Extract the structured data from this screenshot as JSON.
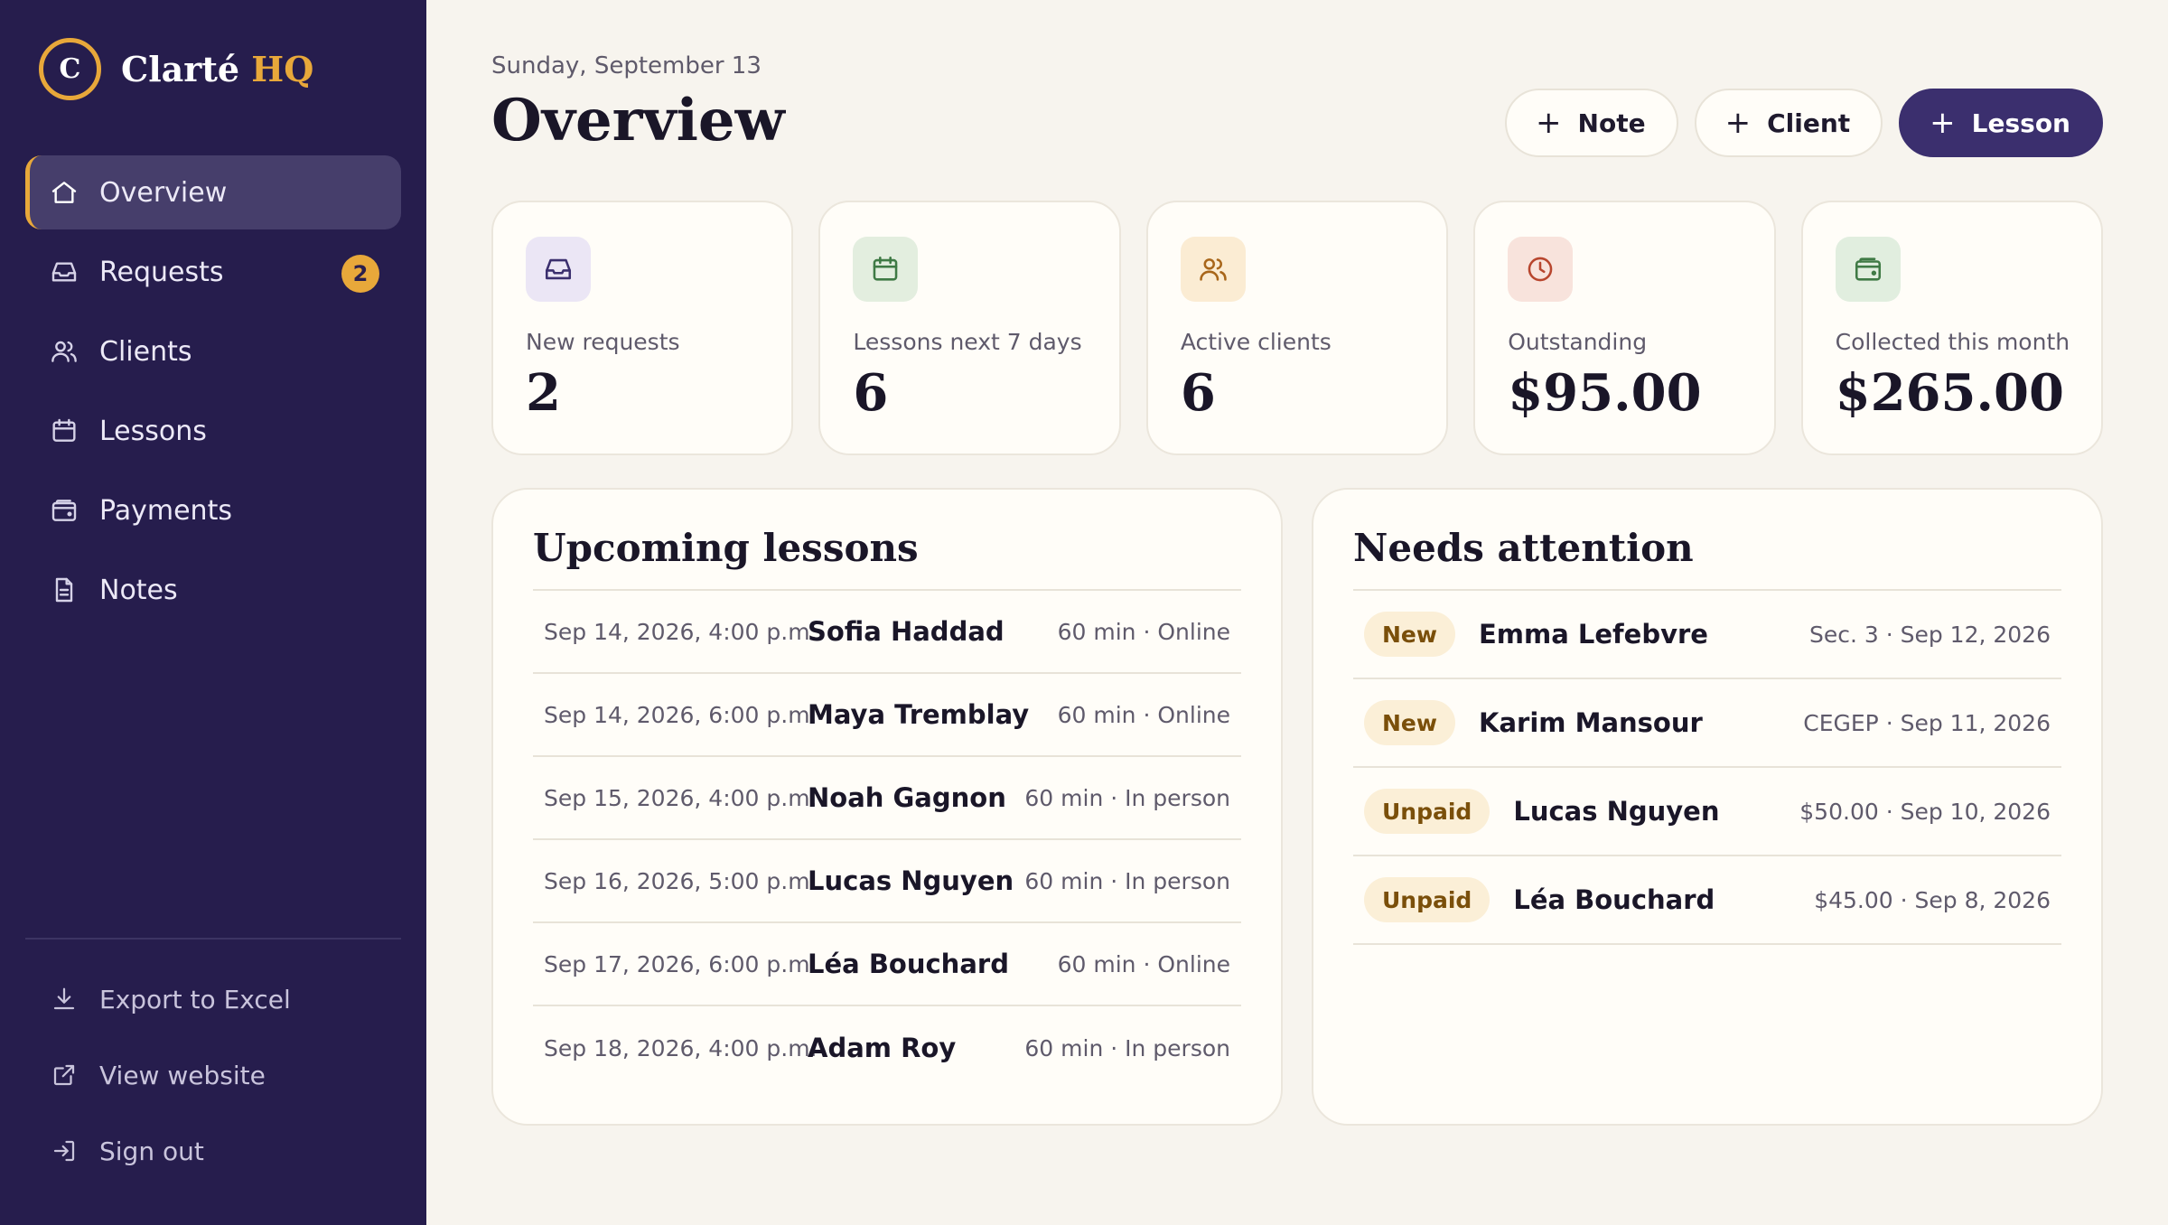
{
  "brand": {
    "logo_letter": "C",
    "name": "Clarté",
    "accent": "HQ",
    "accent_color": "#e8a83a"
  },
  "sidebar": {
    "items": [
      {
        "label": "Overview",
        "icon": "home-icon",
        "active": true
      },
      {
        "label": "Requests",
        "icon": "inbox-icon",
        "badge": "2"
      },
      {
        "label": "Clients",
        "icon": "users-icon"
      },
      {
        "label": "Lessons",
        "icon": "calendar-icon"
      },
      {
        "label": "Payments",
        "icon": "wallet-icon"
      },
      {
        "label": "Notes",
        "icon": "document-icon"
      }
    ],
    "footer": [
      {
        "label": "Export to Excel",
        "icon": "download-icon"
      },
      {
        "label": "View website",
        "icon": "external-link-icon"
      },
      {
        "label": "Sign out",
        "icon": "sign-out-icon"
      }
    ]
  },
  "header": {
    "date": "Sunday, September 13",
    "title": "Overview",
    "actions": [
      {
        "label": "Note",
        "icon": "plus-icon"
      },
      {
        "label": "Client",
        "icon": "plus-icon"
      },
      {
        "label": "Lesson",
        "icon": "plus-icon",
        "primary": true
      }
    ]
  },
  "stats": [
    {
      "label": "New requests",
      "value": "2",
      "icon": "inbox-icon",
      "color": "#ebe6f5"
    },
    {
      "label": "Lessons next 7 days",
      "value": "6",
      "icon": "calendar-icon",
      "color": "#e3eedf"
    },
    {
      "label": "Active clients",
      "value": "6",
      "icon": "users-icon",
      "color": "#fbecd3"
    },
    {
      "label": "Outstanding",
      "value": "$95.00",
      "icon": "clock-icon",
      "color": "#f8e3dc"
    },
    {
      "label": "Collected this month",
      "value": "$265.00",
      "icon": "wallet-icon",
      "color": "#e1eedf"
    }
  ],
  "upcoming": {
    "title": "Upcoming lessons",
    "rows": [
      {
        "when": "Sep 14, 2026, 4:00 p.m.",
        "who": "Sofia Haddad",
        "meta": "60 min · Online"
      },
      {
        "when": "Sep 14, 2026, 6:00 p.m.",
        "who": "Maya Tremblay",
        "meta": "60 min · Online"
      },
      {
        "when": "Sep 15, 2026, 4:00 p.m.",
        "who": "Noah Gagnon",
        "meta": "60 min · In person"
      },
      {
        "when": "Sep 16, 2026, 5:00 p.m.",
        "who": "Lucas Nguyen",
        "meta": "60 min · In person"
      },
      {
        "when": "Sep 17, 2026, 6:00 p.m.",
        "who": "Léa Bouchard",
        "meta": "60 min · Online"
      },
      {
        "when": "Sep 18, 2026, 4:00 p.m.",
        "who": "Adam Roy",
        "meta": "60 min · In person"
      }
    ]
  },
  "attention": {
    "title": "Needs attention",
    "rows": [
      {
        "tag": "New",
        "name": "Emma Lefebvre",
        "meta": "Sec. 3 · Sep 12, 2026"
      },
      {
        "tag": "New",
        "name": "Karim Mansour",
        "meta": "CEGEP · Sep 11, 2026"
      },
      {
        "tag": "Unpaid",
        "name": "Lucas Nguyen",
        "meta": "$50.00 · Sep 10, 2026"
      },
      {
        "tag": "Unpaid",
        "name": "Léa Bouchard",
        "meta": "$45.00 · Sep 8, 2026"
      }
    ]
  }
}
